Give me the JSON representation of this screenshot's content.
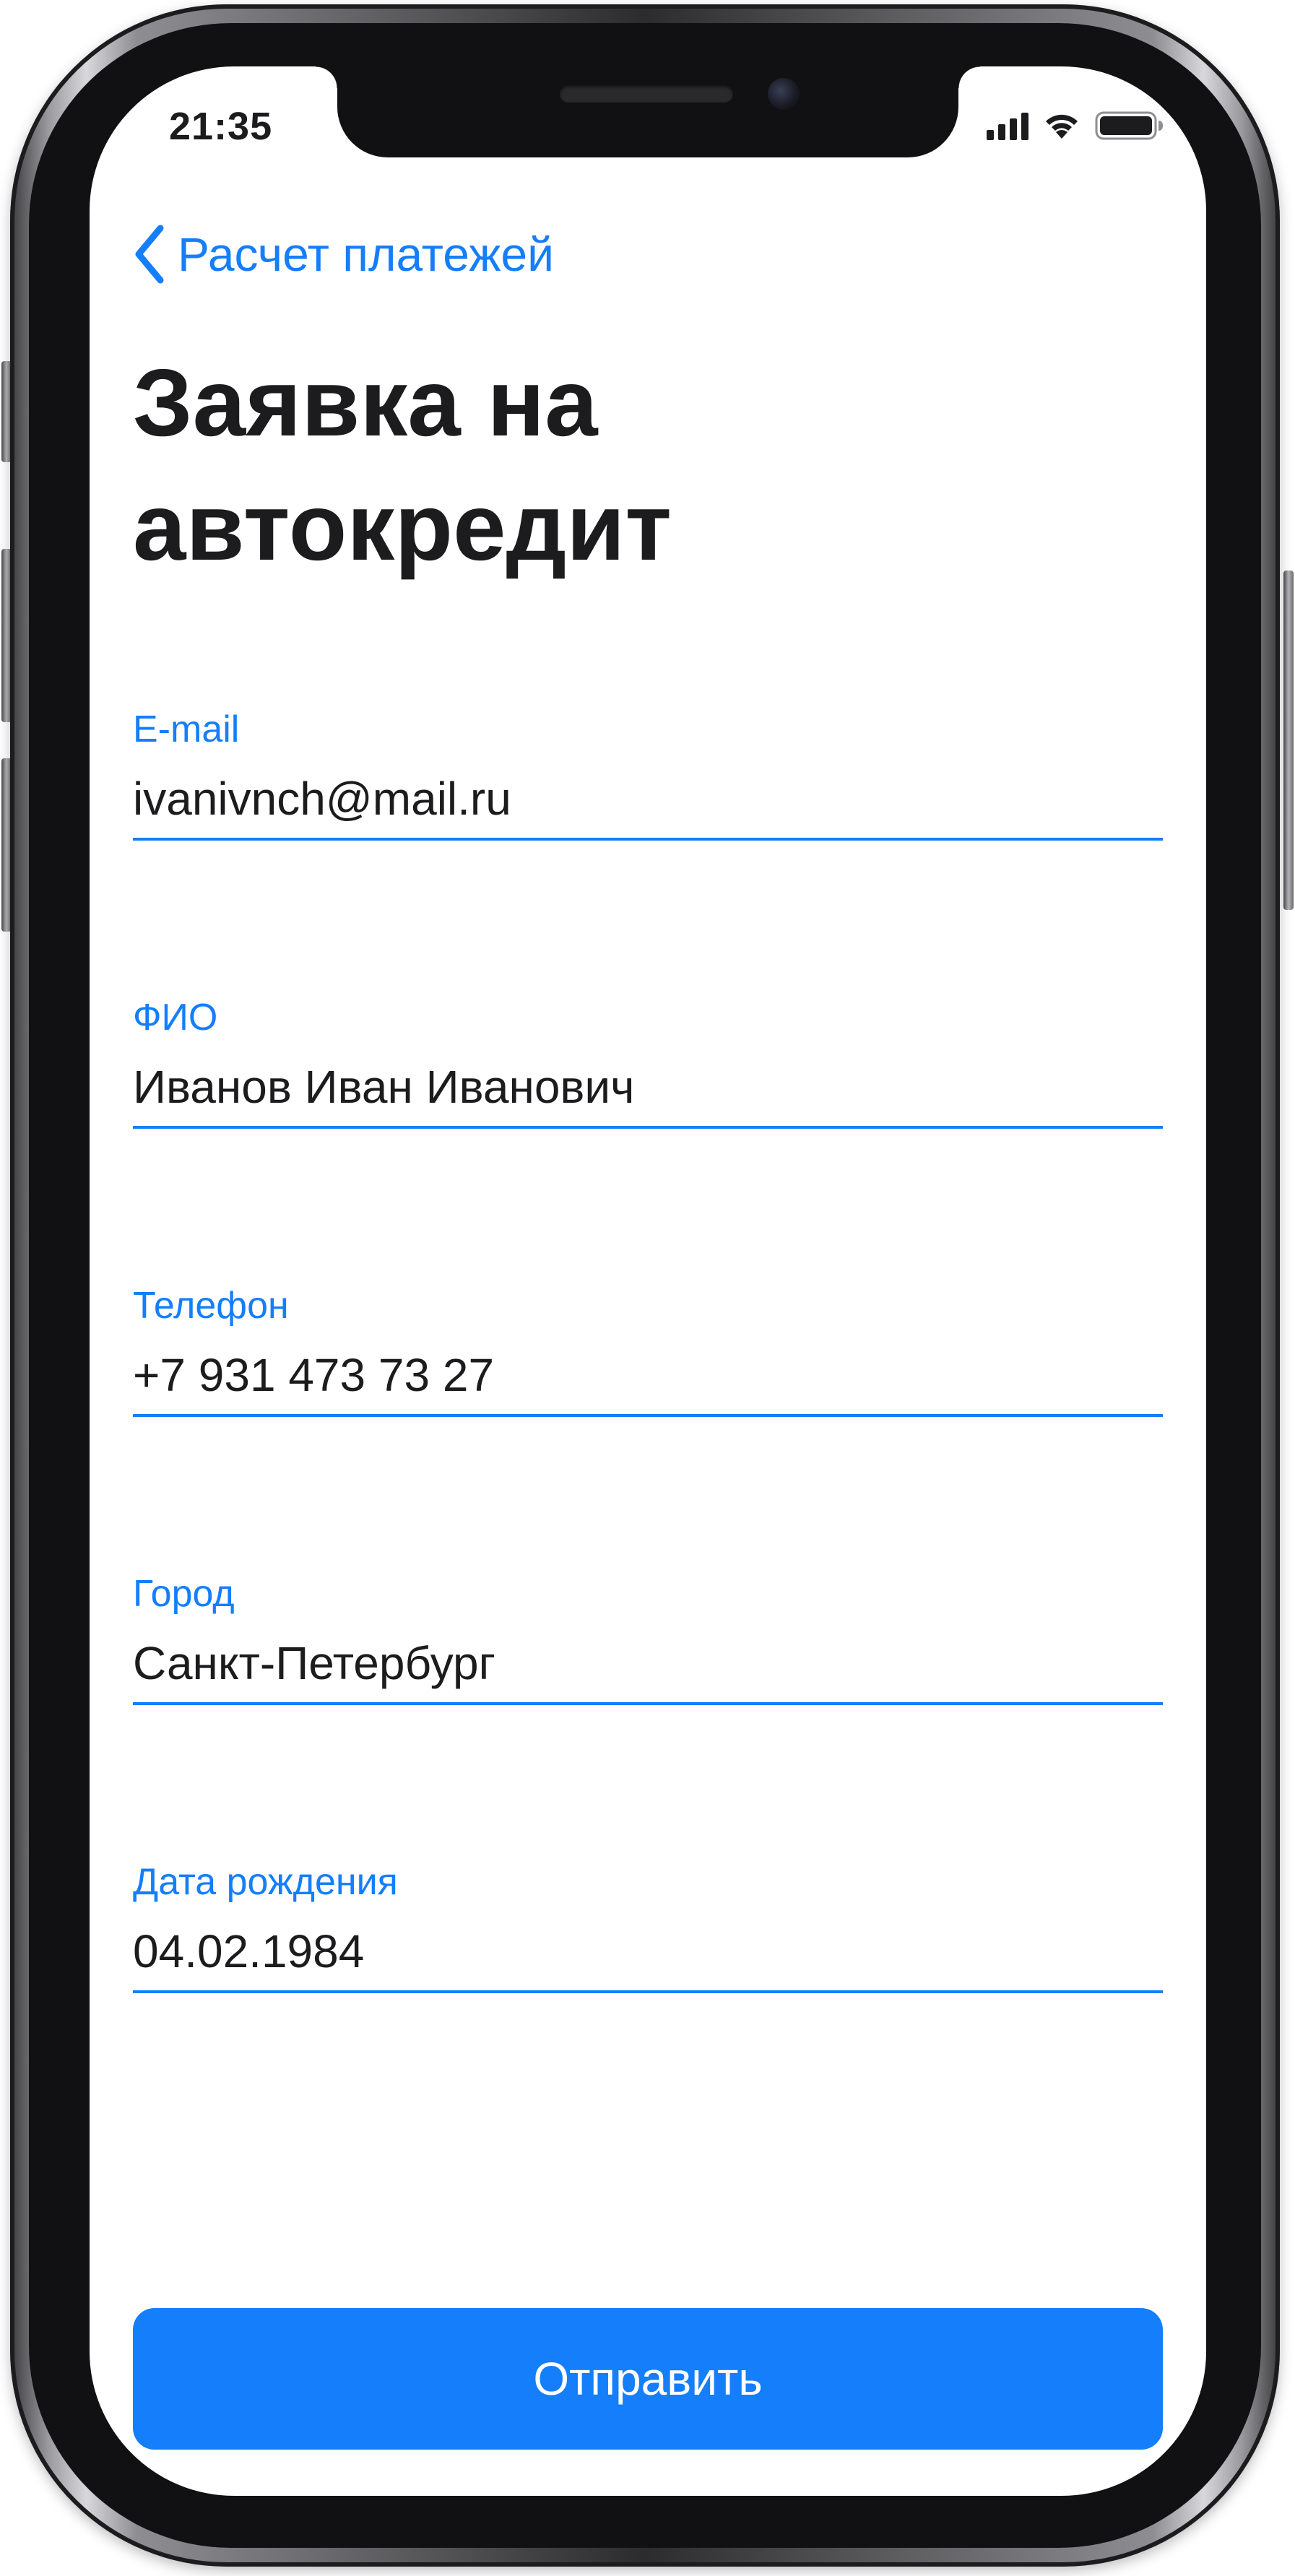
{
  "status_bar": {
    "time": "21:35",
    "icons": [
      "cellular-signal-icon",
      "wifi-icon",
      "battery-icon"
    ]
  },
  "navigation": {
    "back_label": "Расчет платежей",
    "back_icon": "chevron-left-icon"
  },
  "page": {
    "title": "Заявка на автокредит"
  },
  "form": {
    "email": {
      "label": "E-mail",
      "value": "ivanivnch@mail.ru"
    },
    "full_name": {
      "label": "ФИО",
      "value": "Иванов Иван Иванович"
    },
    "phone": {
      "label": "Телефон",
      "value": "+7 931 473 73 27"
    },
    "city": {
      "label": "Город",
      "value": "Санкт-Петербург"
    },
    "birth_date": {
      "label": "Дата рождения",
      "value": "04.02.1984"
    }
  },
  "submit_label": "Отправить",
  "colors": {
    "accent": "#147efb",
    "text": "#1c1c1e",
    "background": "#ffffff"
  }
}
